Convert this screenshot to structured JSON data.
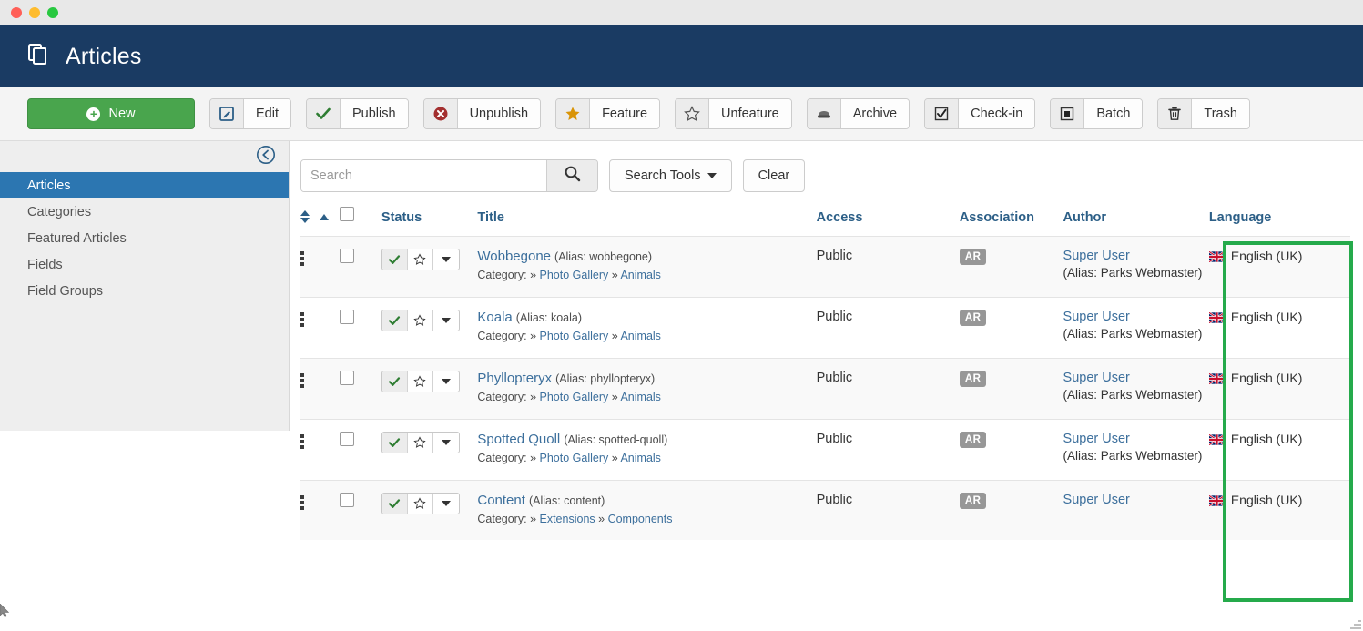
{
  "window": {
    "dots": [
      "close",
      "minimize",
      "zoom"
    ]
  },
  "header": {
    "title": "Articles",
    "icon": "copy-stack-icon"
  },
  "toolbar": {
    "new_label": "New",
    "buttons": [
      {
        "label": "Edit",
        "icon": "pencil-square-icon"
      },
      {
        "label": "Publish",
        "icon": "check-icon"
      },
      {
        "label": "Unpublish",
        "icon": "circle-x-icon"
      },
      {
        "label": "Feature",
        "icon": "star-filled-icon"
      },
      {
        "label": "Unfeature",
        "icon": "star-outline-icon"
      },
      {
        "label": "Archive",
        "icon": "archive-box-icon"
      },
      {
        "label": "Check-in",
        "icon": "checkbox-checked-icon"
      },
      {
        "label": "Batch",
        "icon": "square-filled-icon"
      },
      {
        "label": "Trash",
        "icon": "trash-icon"
      }
    ]
  },
  "sidebar": {
    "collapse_icon": "arrow-circle-left-icon",
    "items": [
      {
        "label": "Articles",
        "active": true
      },
      {
        "label": "Categories",
        "active": false
      },
      {
        "label": "Featured Articles",
        "active": false
      },
      {
        "label": "Fields",
        "active": false
      },
      {
        "label": "Field Groups",
        "active": false
      }
    ]
  },
  "search": {
    "value": "",
    "placeholder": "Search",
    "search_icon": "magnifier-icon",
    "tools_label": "Search Tools",
    "clear_label": "Clear"
  },
  "table": {
    "headers": {
      "ordering": "",
      "checkbox": "",
      "status": "Status",
      "title": "Title",
      "access": "Access",
      "association": "Association",
      "author": "Author",
      "language": "Language"
    },
    "rows": [
      {
        "title": "Wobbegone",
        "alias": "(Alias: wobbegone)",
        "category_label": "Category:",
        "category_path": [
          "Photo Gallery",
          "Animals"
        ],
        "access": "Public",
        "association": "AR",
        "author": "Super User",
        "author_alias": "(Alias: Parks Webmaster)",
        "language": "English (UK)",
        "flag": "uk-flag-icon",
        "status_published": true,
        "featured": false
      },
      {
        "title": "Koala",
        "alias": "(Alias: koala)",
        "category_label": "Category:",
        "category_path": [
          "Photo Gallery",
          "Animals"
        ],
        "access": "Public",
        "association": "AR",
        "author": "Super User",
        "author_alias": "(Alias: Parks Webmaster)",
        "language": "English (UK)",
        "flag": "uk-flag-icon",
        "status_published": true,
        "featured": false
      },
      {
        "title": "Phyllopteryx",
        "alias": "(Alias: phyllopteryx)",
        "category_label": "Category:",
        "category_path": [
          "Photo Gallery",
          "Animals"
        ],
        "access": "Public",
        "association": "AR",
        "author": "Super User",
        "author_alias": "(Alias: Parks Webmaster)",
        "language": "English (UK)",
        "flag": "uk-flag-icon",
        "status_published": true,
        "featured": false
      },
      {
        "title": "Spotted Quoll",
        "alias": "(Alias: spotted-quoll)",
        "category_label": "Category:",
        "category_path": [
          "Photo Gallery",
          "Animals"
        ],
        "access": "Public",
        "association": "AR",
        "author": "Super User",
        "author_alias": "(Alias: Parks Webmaster)",
        "language": "English (UK)",
        "flag": "uk-flag-icon",
        "status_published": true,
        "featured": false
      },
      {
        "title": "Content",
        "alias": "(Alias: content)",
        "category_label": "Category:",
        "category_path": [
          "Extensions",
          "Components"
        ],
        "access": "Public",
        "association": "AR",
        "author": "Super User",
        "author_alias": "",
        "language": "English (UK)",
        "flag": "uk-flag-icon",
        "status_published": true,
        "featured": false
      }
    ]
  },
  "annotation": {
    "type": "highlight-rectangle",
    "color": "#25aa4b",
    "target": "language-column"
  },
  "colors": {
    "header_blue": "#1a3b63",
    "sidebar_active": "#2c76b1",
    "new_green": "#49a54d",
    "link_blue": "#3c6f9c",
    "heading_blue": "#2c5f87",
    "annotation_green": "#25aa4b"
  }
}
